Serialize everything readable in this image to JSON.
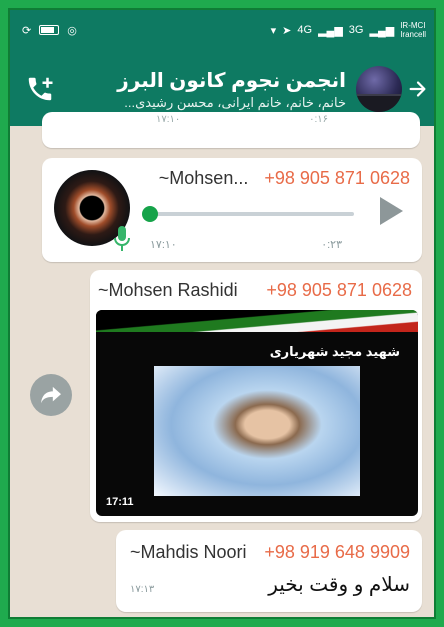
{
  "statusbar": {
    "operator_line1": "IR-MCI",
    "operator_line2": "Irancell",
    "signal_label_1": "4G",
    "signal_label_2": "3G"
  },
  "header": {
    "title": "انجمن نجوم کانون البرز",
    "subtitle": "خانم، خانم، خانم ایرانی، محسن رشیدی..."
  },
  "messages": {
    "previous": {
      "time": "۱۷:۱۰",
      "duration": "۰:۱۶"
    },
    "voice": {
      "sender_name": "~Mohsen...",
      "sender_phone": "+98 905 871 0628",
      "time": "۱۷:۱۰",
      "duration": "۰:۲۳",
      "progress_fraction": 0
    },
    "image": {
      "sender_name": "~Mohsen Rashidi",
      "sender_phone": "+98 905 871 0628",
      "caption": "شهید مجید شهریاری",
      "time": "17:11"
    },
    "text": {
      "sender_name": "~Mahdis Noori",
      "sender_phone": "+98 919 648 9909",
      "body": "سلام و وقت بخیر",
      "time": "۱۷:۱۳"
    }
  },
  "colors": {
    "header_bg": "#0e7a62",
    "phone_accent": "#e86b48",
    "chat_bg": "#e8dfd4",
    "frame_border": "#1faa4e"
  }
}
